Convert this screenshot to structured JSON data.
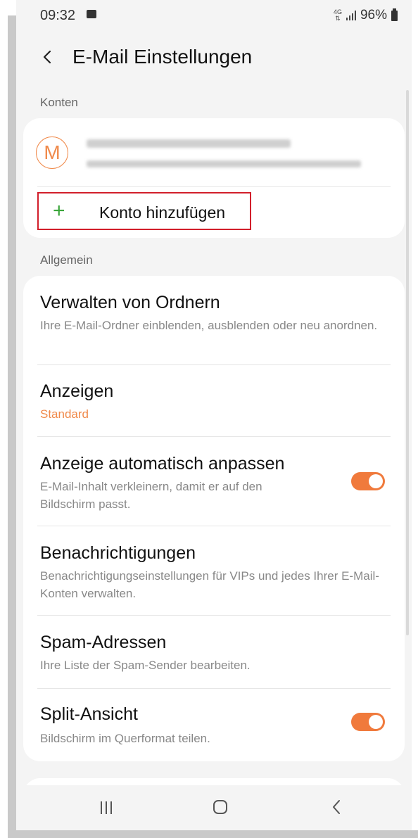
{
  "status": {
    "time": "09:32",
    "network": "4G",
    "battery": "96%"
  },
  "header": {
    "title": "E-Mail Einstellungen"
  },
  "accounts": {
    "section_label": "Konten",
    "avatar_letter": "M",
    "add_label": "Konto hinzufügen"
  },
  "general": {
    "section_label": "Allgemein",
    "items": [
      {
        "title": "Verwalten von Ordnern",
        "desc": "Ihre E-Mail-Ordner einblenden, ausblenden oder neu anordnen."
      },
      {
        "title": "Anzeigen",
        "value": "Standard"
      },
      {
        "title": "Anzeige automatisch anpassen",
        "desc": "E-Mail-Inhalt verkleinern, damit er auf den Bildschirm passt.",
        "toggle": true
      },
      {
        "title": "Benachrichtigungen",
        "desc": "Benachrichtigungseinstellungen für VIPs und jedes Ihrer E-Mail-Konten verwalten."
      },
      {
        "title": "Spam-Adressen",
        "desc": "Ihre Liste der Spam-Sender bearbeiten."
      },
      {
        "title": "Split-Ansicht",
        "desc": "Bildschirm im Querformat teilen.",
        "toggle": true
      }
    ]
  },
  "colors": {
    "accent": "#f07a3c",
    "add_highlight": "#d21f2b",
    "plus": "#3aa53a"
  },
  "icons": {
    "back": "chevron-left-icon",
    "recent": "recent-apps-icon",
    "home": "home-icon",
    "nav_back": "nav-back-icon"
  }
}
